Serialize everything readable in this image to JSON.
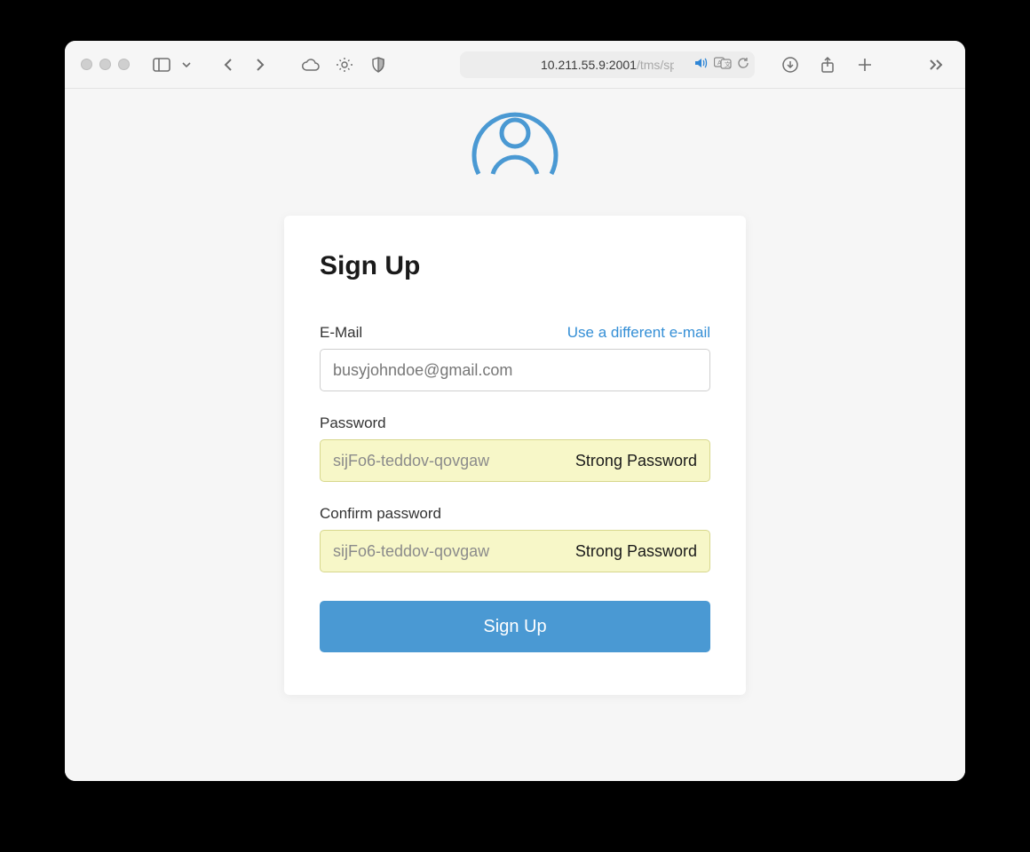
{
  "browser": {
    "url_display_main": "10.211.55.9:2001",
    "url_display_path": "/tms/sp"
  },
  "signup": {
    "title": "Sign Up",
    "email_label": "E-Mail",
    "email_alt_link": "Use a different e-mail",
    "email_value": "busyjohndoe@gmail.com",
    "password_label": "Password",
    "password_value": "sijFo6-teddov-qovgaw",
    "password_strength": "Strong Password",
    "confirm_label": "Confirm password",
    "confirm_value": "sijFo6-teddov-qovgaw",
    "confirm_strength": "Strong Password",
    "submit_label": "Sign Up"
  }
}
